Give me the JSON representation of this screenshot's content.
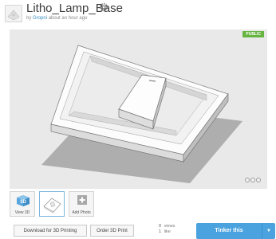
{
  "header": {
    "title": "Litho_Lamp_Base",
    "by": "by",
    "author": "Gropni",
    "time": "about an hour ago"
  },
  "viewer": {
    "badge": "PUBLIC",
    "badge_color": "#67b541"
  },
  "thumbnails": [
    {
      "label": "View 3D",
      "icon": "cube-3d-icon"
    },
    {
      "label": "",
      "icon": "model-thumbnail"
    },
    {
      "label": "Add Photo",
      "icon": "plus-icon"
    }
  ],
  "footer": {
    "download": "Download for 3D Printing",
    "order": "Order 3D Print",
    "views_count": "0",
    "views_label": "views",
    "likes_count": "1",
    "likes_label": "like",
    "tinker": "Tinker this",
    "accent": "#4aa3df"
  }
}
